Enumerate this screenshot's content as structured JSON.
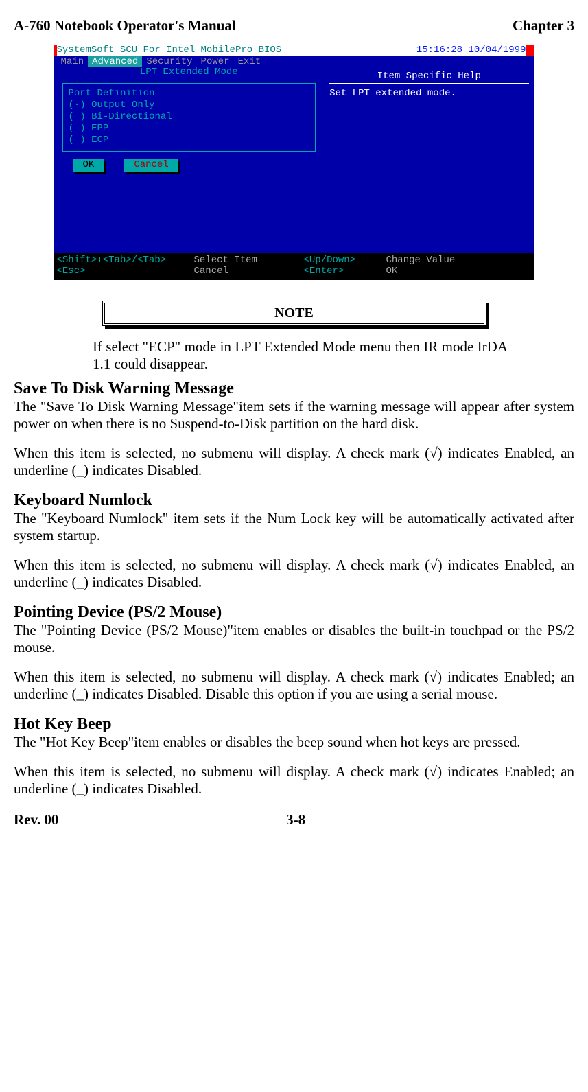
{
  "header": {
    "left": "A-760 Notebook Operator's Manual",
    "right": "Chapter 3"
  },
  "bios": {
    "top_title": "SystemSoft SCU For Intel MobilePro BIOS",
    "top_time": "15:16:28  10/04/1999",
    "menu": {
      "main": "Main",
      "advanced": "Advanced",
      "security": "Security",
      "power": "Power",
      "exit": "Exit"
    },
    "dialog_title": "LPT Extended Mode",
    "port_def": "Port Definition",
    "opt1": "(·) Output Only",
    "opt2": "( ) Bi-Directional",
    "opt3": "( ) EPP",
    "opt4": "( ) ECP",
    "ok": "OK",
    "cancel": "Cancel",
    "help_title": "Item Specific Help",
    "help_text": "Set LPT extended mode.",
    "f1a": "<Shift>+<Tab>/<Tab>",
    "f1b": "Select Item",
    "f1c": "<Up/Down>",
    "f1d": "Change Value",
    "f2a": "<Esc>",
    "f2b": "Cancel",
    "f2c": "<Enter>",
    "f2d": "OK"
  },
  "note": {
    "label": "NOTE",
    "text": "If select \"ECP\" mode in LPT Extended Mode menu then IR mode IrDA 1.1 could disappear."
  },
  "s1": {
    "h": "Save To Disk Warning Message",
    "p1": "The \"Save To Disk Warning Message\"item sets if the warning message will appear after system power on when there is no Suspend-to-Disk partition on the hard disk.",
    "p2": "When this item is selected, no submenu will display. A check mark (√) indicates Enabled, an underline (_) indicates Disabled."
  },
  "s2": {
    "h": "Keyboard Numlock",
    "p1": "The \"Keyboard Numlock\" item sets if the Num Lock key will be automatically activated after system startup.",
    "p2": "When this item is selected, no submenu will display. A check mark (√) indicates Enabled, an underline (_) indicates Disabled."
  },
  "s3": {
    "h": "Pointing Device (PS/2 Mouse)",
    "p1": "The \"Pointing Device (PS/2 Mouse)\"item enables or disables the built-in touchpad or the PS/2 mouse.",
    "p2": "When this item is selected, no submenu will display. A check mark (√) indicates Enabled; an underline (_) indicates Disabled. Disable this option if you are using a serial mouse."
  },
  "s4": {
    "h": "Hot Key Beep",
    "p1": "The \"Hot Key Beep\"item enables or disables the beep sound when hot keys are pressed.",
    "p2": "When this item is selected, no submenu will display. A check mark (√) indicates Enabled; an underline (_) indicates Disabled."
  },
  "footer": {
    "left": "Rev. 00",
    "page": "3-8"
  }
}
